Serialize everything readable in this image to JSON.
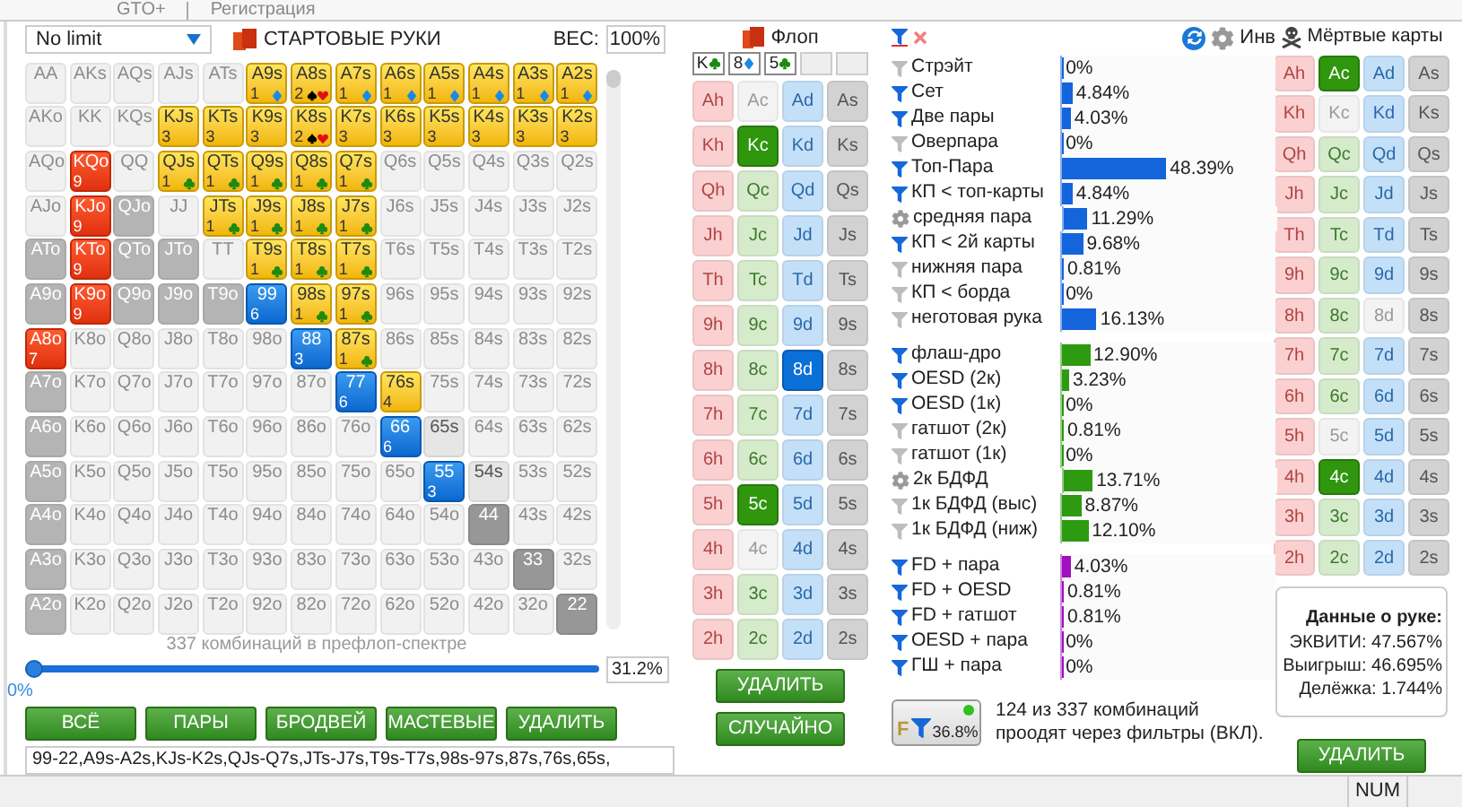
{
  "top_tabs": [
    {
      "label": "GTO+"
    },
    {
      "label": "Регистрация"
    }
  ],
  "preflop": {
    "game": "No limit",
    "title": "СТАРТОВЫЕ РУКИ",
    "weight_label": "ВЕС:",
    "weight": "100%",
    "matrix": [
      [
        {
          "label": "AA",
          "kind": "off"
        },
        {
          "label": "AKs",
          "kind": "off"
        },
        {
          "label": "AQs",
          "kind": "off"
        },
        {
          "label": "AJs",
          "kind": "off"
        },
        {
          "label": "ATs",
          "kind": "off"
        },
        {
          "label": "A9s",
          "kind": "yellow",
          "count": "1",
          "suits": [
            {
              "kind": "diamond"
            }
          ]
        },
        {
          "label": "A8s",
          "kind": "yellow",
          "count": "2",
          "suits": [
            {
              "kind": "spade"
            },
            {
              "kind": "heart"
            }
          ]
        },
        {
          "label": "A7s",
          "kind": "yellow",
          "count": "1",
          "suits": [
            {
              "kind": "diamond"
            }
          ]
        },
        {
          "label": "A6s",
          "kind": "yellow",
          "count": "1",
          "suits": [
            {
              "kind": "diamond"
            }
          ]
        },
        {
          "label": "A5s",
          "kind": "yellow",
          "count": "1",
          "suits": [
            {
              "kind": "diamond"
            }
          ]
        },
        {
          "label": "A4s",
          "kind": "yellow",
          "count": "1",
          "suits": [
            {
              "kind": "diamond"
            }
          ]
        },
        {
          "label": "A3s",
          "kind": "yellow",
          "count": "1",
          "suits": [
            {
              "kind": "diamond"
            }
          ]
        },
        {
          "label": "A2s",
          "kind": "yellow",
          "count": "1",
          "suits": [
            {
              "kind": "diamond"
            }
          ]
        }
      ],
      [
        {
          "label": "AKo",
          "kind": "off"
        },
        {
          "label": "KK",
          "kind": "off"
        },
        {
          "label": "KQs",
          "kind": "off"
        },
        {
          "label": "KJs",
          "kind": "yellow",
          "count": "3"
        },
        {
          "label": "KTs",
          "kind": "yellow",
          "count": "3"
        },
        {
          "label": "K9s",
          "kind": "yellow",
          "count": "3"
        },
        {
          "label": "K8s",
          "kind": "yellow",
          "count": "2",
          "suits": [
            {
              "kind": "spade"
            },
            {
              "kind": "heart"
            }
          ]
        },
        {
          "label": "K7s",
          "kind": "yellow",
          "count": "3"
        },
        {
          "label": "K6s",
          "kind": "yellow",
          "count": "3"
        },
        {
          "label": "K5s",
          "kind": "yellow",
          "count": "3"
        },
        {
          "label": "K4s",
          "kind": "yellow",
          "count": "3"
        },
        {
          "label": "K3s",
          "kind": "yellow",
          "count": "3"
        },
        {
          "label": "K2s",
          "kind": "yellow",
          "count": "3"
        }
      ],
      [
        {
          "label": "AQo",
          "kind": "off"
        },
        {
          "label": "KQo",
          "kind": "red",
          "count": "9"
        },
        {
          "label": "QQ",
          "kind": "off"
        },
        {
          "label": "QJs",
          "kind": "yellow",
          "count": "1",
          "suits": [
            {
              "kind": "club"
            }
          ]
        },
        {
          "label": "QTs",
          "kind": "yellow",
          "count": "1",
          "suits": [
            {
              "kind": "club"
            }
          ]
        },
        {
          "label": "Q9s",
          "kind": "yellow",
          "count": "1",
          "suits": [
            {
              "kind": "club"
            }
          ]
        },
        {
          "label": "Q8s",
          "kind": "yellow",
          "count": "1",
          "suits": [
            {
              "kind": "club"
            }
          ]
        },
        {
          "label": "Q7s",
          "kind": "yellow",
          "count": "1",
          "suits": [
            {
              "kind": "club"
            }
          ]
        },
        {
          "label": "Q6s",
          "kind": "off"
        },
        {
          "label": "Q5s",
          "kind": "off"
        },
        {
          "label": "Q4s",
          "kind": "off"
        },
        {
          "label": "Q3s",
          "kind": "off"
        },
        {
          "label": "Q2s",
          "kind": "off"
        }
      ],
      [
        {
          "label": "AJo",
          "kind": "off"
        },
        {
          "label": "KJo",
          "kind": "red",
          "count": "9"
        },
        {
          "label": "QJo",
          "kind": "grey"
        },
        {
          "label": "JJ",
          "kind": "off"
        },
        {
          "label": "JTs",
          "kind": "yellow",
          "count": "1",
          "suits": [
            {
              "kind": "club"
            }
          ]
        },
        {
          "label": "J9s",
          "kind": "yellow",
          "count": "1",
          "suits": [
            {
              "kind": "club"
            }
          ]
        },
        {
          "label": "J8s",
          "kind": "yellow",
          "count": "1",
          "suits": [
            {
              "kind": "club"
            }
          ]
        },
        {
          "label": "J7s",
          "kind": "yellow",
          "count": "1",
          "suits": [
            {
              "kind": "club"
            }
          ]
        },
        {
          "label": "J6s",
          "kind": "off"
        },
        {
          "label": "J5s",
          "kind": "off"
        },
        {
          "label": "J4s",
          "kind": "off"
        },
        {
          "label": "J3s",
          "kind": "off"
        },
        {
          "label": "J2s",
          "kind": "off"
        }
      ],
      [
        {
          "label": "ATo",
          "kind": "grey"
        },
        {
          "label": "KTo",
          "kind": "red",
          "count": "9"
        },
        {
          "label": "QTo",
          "kind": "grey"
        },
        {
          "label": "JTo",
          "kind": "grey"
        },
        {
          "label": "TT",
          "kind": "off"
        },
        {
          "label": "T9s",
          "kind": "yellow",
          "count": "1",
          "suits": [
            {
              "kind": "club"
            }
          ]
        },
        {
          "label": "T8s",
          "kind": "yellow",
          "count": "1",
          "suits": [
            {
              "kind": "club"
            }
          ]
        },
        {
          "label": "T7s",
          "kind": "yellow",
          "count": "1",
          "suits": [
            {
              "kind": "club"
            }
          ]
        },
        {
          "label": "T6s",
          "kind": "off"
        },
        {
          "label": "T5s",
          "kind": "off"
        },
        {
          "label": "T4s",
          "kind": "off"
        },
        {
          "label": "T3s",
          "kind": "off"
        },
        {
          "label": "T2s",
          "kind": "off"
        }
      ],
      [
        {
          "label": "A9o",
          "kind": "grey"
        },
        {
          "label": "K9o",
          "kind": "red",
          "count": "9"
        },
        {
          "label": "Q9o",
          "kind": "grey"
        },
        {
          "label": "J9o",
          "kind": "grey"
        },
        {
          "label": "T9o",
          "kind": "grey"
        },
        {
          "label": "99",
          "kind": "blue",
          "count": "6"
        },
        {
          "label": "98s",
          "kind": "yellow",
          "count": "1",
          "suits": [
            {
              "kind": "club"
            }
          ]
        },
        {
          "label": "97s",
          "kind": "yellow",
          "count": "1",
          "suits": [
            {
              "kind": "club"
            }
          ]
        },
        {
          "label": "96s",
          "kind": "off"
        },
        {
          "label": "95s",
          "kind": "off"
        },
        {
          "label": "94s",
          "kind": "off"
        },
        {
          "label": "93s",
          "kind": "off"
        },
        {
          "label": "92s",
          "kind": "off"
        }
      ],
      [
        {
          "label": "A8o",
          "kind": "red",
          "count": "7"
        },
        {
          "label": "K8o",
          "kind": "off"
        },
        {
          "label": "Q8o",
          "kind": "off"
        },
        {
          "label": "J8o",
          "kind": "off"
        },
        {
          "label": "T8o",
          "kind": "off"
        },
        {
          "label": "98o",
          "kind": "off"
        },
        {
          "label": "88",
          "kind": "blue",
          "count": "3"
        },
        {
          "label": "87s",
          "kind": "yellow",
          "count": "1",
          "suits": [
            {
              "kind": "club"
            }
          ]
        },
        {
          "label": "86s",
          "kind": "off"
        },
        {
          "label": "85s",
          "kind": "off"
        },
        {
          "label": "84s",
          "kind": "off"
        },
        {
          "label": "83s",
          "kind": "off"
        },
        {
          "label": "82s",
          "kind": "off"
        }
      ],
      [
        {
          "label": "A7o",
          "kind": "grey"
        },
        {
          "label": "K7o",
          "kind": "off"
        },
        {
          "label": "Q7o",
          "kind": "off"
        },
        {
          "label": "J7o",
          "kind": "off"
        },
        {
          "label": "T7o",
          "kind": "off"
        },
        {
          "label": "97o",
          "kind": "off"
        },
        {
          "label": "87o",
          "kind": "off"
        },
        {
          "label": "77",
          "kind": "blue",
          "count": "6"
        },
        {
          "label": "76s",
          "kind": "yellow",
          "count": "4"
        },
        {
          "label": "75s",
          "kind": "off"
        },
        {
          "label": "74s",
          "kind": "off"
        },
        {
          "label": "73s",
          "kind": "off"
        },
        {
          "label": "72s",
          "kind": "off"
        }
      ],
      [
        {
          "label": "A6o",
          "kind": "grey"
        },
        {
          "label": "K6o",
          "kind": "off"
        },
        {
          "label": "Q6o",
          "kind": "off"
        },
        {
          "label": "J6o",
          "kind": "off"
        },
        {
          "label": "T6o",
          "kind": "off"
        },
        {
          "label": "96o",
          "kind": "off"
        },
        {
          "label": "86o",
          "kind": "off"
        },
        {
          "label": "76o",
          "kind": "off"
        },
        {
          "label": "66",
          "kind": "blue",
          "count": "6"
        },
        {
          "label": "65s",
          "kind": "mid"
        },
        {
          "label": "64s",
          "kind": "off"
        },
        {
          "label": "63s",
          "kind": "off"
        },
        {
          "label": "62s",
          "kind": "off"
        }
      ],
      [
        {
          "label": "A5o",
          "kind": "grey"
        },
        {
          "label": "K5o",
          "kind": "off"
        },
        {
          "label": "Q5o",
          "kind": "off"
        },
        {
          "label": "J5o",
          "kind": "off"
        },
        {
          "label": "T5o",
          "kind": "off"
        },
        {
          "label": "95o",
          "kind": "off"
        },
        {
          "label": "85o",
          "kind": "off"
        },
        {
          "label": "75o",
          "kind": "off"
        },
        {
          "label": "65o",
          "kind": "off"
        },
        {
          "label": "55",
          "kind": "blue",
          "count": "3"
        },
        {
          "label": "54s",
          "kind": "mid"
        },
        {
          "label": "53s",
          "kind": "off"
        },
        {
          "label": "52s",
          "kind": "off"
        }
      ],
      [
        {
          "label": "A4o",
          "kind": "grey"
        },
        {
          "label": "K4o",
          "kind": "off"
        },
        {
          "label": "Q4o",
          "kind": "off"
        },
        {
          "label": "J4o",
          "kind": "off"
        },
        {
          "label": "T4o",
          "kind": "off"
        },
        {
          "label": "94o",
          "kind": "off"
        },
        {
          "label": "84o",
          "kind": "off"
        },
        {
          "label": "74o",
          "kind": "off"
        },
        {
          "label": "64o",
          "kind": "off"
        },
        {
          "label": "54o",
          "kind": "off"
        },
        {
          "label": "44",
          "kind": "dark"
        },
        {
          "label": "43s",
          "kind": "off"
        },
        {
          "label": "42s",
          "kind": "off"
        }
      ],
      [
        {
          "label": "A3o",
          "kind": "grey"
        },
        {
          "label": "K3o",
          "kind": "off"
        },
        {
          "label": "Q3o",
          "kind": "off"
        },
        {
          "label": "J3o",
          "kind": "off"
        },
        {
          "label": "T3o",
          "kind": "off"
        },
        {
          "label": "93o",
          "kind": "off"
        },
        {
          "label": "83o",
          "kind": "off"
        },
        {
          "label": "73o",
          "kind": "off"
        },
        {
          "label": "63o",
          "kind": "off"
        },
        {
          "label": "53o",
          "kind": "off"
        },
        {
          "label": "43o",
          "kind": "off"
        },
        {
          "label": "33",
          "kind": "dark"
        },
        {
          "label": "32s",
          "kind": "off"
        }
      ],
      [
        {
          "label": "A2o",
          "kind": "grey"
        },
        {
          "label": "K2o",
          "kind": "off"
        },
        {
          "label": "Q2o",
          "kind": "off"
        },
        {
          "label": "J2o",
          "kind": "off"
        },
        {
          "label": "T2o",
          "kind": "off"
        },
        {
          "label": "92o",
          "kind": "off"
        },
        {
          "label": "82o",
          "kind": "off"
        },
        {
          "label": "72o",
          "kind": "off"
        },
        {
          "label": "62o",
          "kind": "off"
        },
        {
          "label": "52o",
          "kind": "off"
        },
        {
          "label": "42o",
          "kind": "off"
        },
        {
          "label": "32o",
          "kind": "off"
        },
        {
          "label": "22",
          "kind": "dark"
        }
      ]
    ],
    "combos_caption": "337 комбинаций в префлоп-спектре",
    "slider": {
      "level": 0,
      "min_label": "0%",
      "max_value": "31.2%"
    },
    "buttons": [
      "ВСЁ",
      "ПАРЫ",
      "БРОДВЕЙ",
      "МАСТЕВЫЕ",
      "УДАЛИТЬ"
    ],
    "range_text": "99-22,A9s-A2s,KJs-K2s,QJs-Q7s,JTs-J7s,T9s-T7s,98s-97s,87s,76s,65s,"
  },
  "flop": {
    "title": "Флоп",
    "board": [
      {
        "kind": "club",
        "rank": "K"
      },
      {
        "kind": "diamond",
        "rank": "8"
      },
      {
        "kind": "club",
        "rank": "5"
      },
      {
        "kind": "empty"
      },
      {
        "kind": "empty"
      }
    ],
    "cards": [
      [
        {
          "label": "Ah",
          "selected": false,
          "disabled": false
        },
        {
          "label": "Ac",
          "selected": false,
          "disabled": true
        },
        {
          "label": "Ad",
          "selected": false,
          "disabled": false
        },
        {
          "label": "As",
          "selected": false,
          "disabled": false
        }
      ],
      [
        {
          "label": "Kh",
          "selected": false,
          "disabled": false
        },
        {
          "label": "Kc",
          "selected": true,
          "disabled": false
        },
        {
          "label": "Kd",
          "selected": false,
          "disabled": false
        },
        {
          "label": "Ks",
          "selected": false,
          "disabled": false
        }
      ],
      [
        {
          "label": "Qh",
          "selected": false,
          "disabled": false
        },
        {
          "label": "Qc",
          "selected": false,
          "disabled": false
        },
        {
          "label": "Qd",
          "selected": false,
          "disabled": false
        },
        {
          "label": "Qs",
          "selected": false,
          "disabled": false
        }
      ],
      [
        {
          "label": "Jh",
          "selected": false,
          "disabled": false
        },
        {
          "label": "Jc",
          "selected": false,
          "disabled": false
        },
        {
          "label": "Jd",
          "selected": false,
          "disabled": false
        },
        {
          "label": "Js",
          "selected": false,
          "disabled": false
        }
      ],
      [
        {
          "label": "Th",
          "selected": false,
          "disabled": false
        },
        {
          "label": "Tc",
          "selected": false,
          "disabled": false
        },
        {
          "label": "Td",
          "selected": false,
          "disabled": false
        },
        {
          "label": "Ts",
          "selected": false,
          "disabled": false
        }
      ],
      [
        {
          "label": "9h",
          "selected": false,
          "disabled": false
        },
        {
          "label": "9c",
          "selected": false,
          "disabled": false
        },
        {
          "label": "9d",
          "selected": false,
          "disabled": false
        },
        {
          "label": "9s",
          "selected": false,
          "disabled": false
        }
      ],
      [
        {
          "label": "8h",
          "selected": false,
          "disabled": false
        },
        {
          "label": "8c",
          "selected": false,
          "disabled": false
        },
        {
          "label": "8d",
          "selected": true,
          "disabled": false
        },
        {
          "label": "8s",
          "selected": false,
          "disabled": false
        }
      ],
      [
        {
          "label": "7h",
          "selected": false,
          "disabled": false
        },
        {
          "label": "7c",
          "selected": false,
          "disabled": false
        },
        {
          "label": "7d",
          "selected": false,
          "disabled": false
        },
        {
          "label": "7s",
          "selected": false,
          "disabled": false
        }
      ],
      [
        {
          "label": "6h",
          "selected": false,
          "disabled": false
        },
        {
          "label": "6c",
          "selected": false,
          "disabled": false
        },
        {
          "label": "6d",
          "selected": false,
          "disabled": false
        },
        {
          "label": "6s",
          "selected": false,
          "disabled": false
        }
      ],
      [
        {
          "label": "5h",
          "selected": false,
          "disabled": false
        },
        {
          "label": "5c",
          "selected": true,
          "disabled": false
        },
        {
          "label": "5d",
          "selected": false,
          "disabled": false
        },
        {
          "label": "5s",
          "selected": false,
          "disabled": false
        }
      ],
      [
        {
          "label": "4h",
          "selected": false,
          "disabled": false
        },
        {
          "label": "4c",
          "selected": false,
          "disabled": true
        },
        {
          "label": "4d",
          "selected": false,
          "disabled": false
        },
        {
          "label": "4s",
          "selected": false,
          "disabled": false
        }
      ],
      [
        {
          "label": "3h",
          "selected": false,
          "disabled": false
        },
        {
          "label": "3c",
          "selected": false,
          "disabled": false
        },
        {
          "label": "3d",
          "selected": false,
          "disabled": false
        },
        {
          "label": "3s",
          "selected": false,
          "disabled": false
        }
      ],
      [
        {
          "label": "2h",
          "selected": false,
          "disabled": false
        },
        {
          "label": "2c",
          "selected": false,
          "disabled": false
        },
        {
          "label": "2d",
          "selected": false,
          "disabled": false
        },
        {
          "label": "2s",
          "selected": false,
          "disabled": false
        }
      ]
    ],
    "buttons": [
      "УДАЛИТЬ",
      "СЛУЧАЙНО"
    ]
  },
  "stats": {
    "groups": [
      {
        "color": "#1464dc",
        "rows": [
          {
            "kind": "off",
            "label": "Стрэйт",
            "value": "0%",
            "level": 0
          },
          {
            "kind": "on",
            "label": "Сет",
            "value": "4.84%",
            "level": 0.0484
          },
          {
            "kind": "on",
            "label": "Две пары",
            "value": "4.03%",
            "level": 0.0403
          },
          {
            "kind": "off",
            "label": "Оверпара",
            "value": "0%",
            "level": 0
          },
          {
            "kind": "on",
            "label": "Топ-Пара",
            "value": "48.39%",
            "level": 0.4839
          },
          {
            "kind": "on",
            "label": "КП < топ-карты",
            "value": "4.84%",
            "level": 0.0484
          },
          {
            "kind": "gear",
            "label": "средняя пара",
            "value": "11.29%",
            "level": 0.1129
          },
          {
            "kind": "on",
            "label": "КП < 2й карты",
            "value": "9.68%",
            "level": 0.0968
          },
          {
            "kind": "off",
            "label": "нижняя пара",
            "value": "0.81%",
            "level": 0.0081
          },
          {
            "kind": "off",
            "label": "КП < борда",
            "value": "0%",
            "level": 0
          },
          {
            "kind": "off",
            "label": "неготовая рука",
            "value": "16.13%",
            "level": 0.1613
          }
        ]
      },
      {
        "color": "#2e9a12",
        "rows": [
          {
            "kind": "on",
            "label": "флаш-дро",
            "value": "12.90%",
            "level": 0.129
          },
          {
            "kind": "on",
            "label": "OESD (2к)",
            "value": "3.23%",
            "level": 0.0323
          },
          {
            "kind": "on",
            "label": "OESD (1к)",
            "value": "0%",
            "level": 0
          },
          {
            "kind": "off",
            "label": "гатшот (2к)",
            "value": "0.81%",
            "level": 0.0081
          },
          {
            "kind": "off",
            "label": "гатшот (1к)",
            "value": "0%",
            "level": 0
          },
          {
            "kind": "gear",
            "label": "2к БДФД",
            "value": "13.71%",
            "level": 0.1371
          },
          {
            "kind": "off",
            "label": "1к БДФД (выс)",
            "value": "8.87%",
            "level": 0.0887
          },
          {
            "kind": "off",
            "label": "1к БДФД (ниж)",
            "value": "12.10%",
            "level": 0.121
          }
        ]
      },
      {
        "color": "#a010c0",
        "rows": [
          {
            "kind": "on",
            "label": "FD + пара",
            "value": "4.03%",
            "level": 0.0403
          },
          {
            "kind": "on",
            "label": "FD + OESD",
            "value": "0.81%",
            "level": 0.0081
          },
          {
            "kind": "on",
            "label": "FD + гатшот",
            "value": "0.81%",
            "level": 0.0081
          },
          {
            "kind": "on",
            "label": "OESD + пара",
            "value": "0%",
            "level": 0
          },
          {
            "kind": "on",
            "label": "ГШ + пара",
            "value": "0%",
            "level": 0
          }
        ]
      }
    ],
    "inv_label": "Инв",
    "filter_button": {
      "letter": "F",
      "value": "36.8%",
      "on": true
    },
    "summary": "124 из 337 комбинаций проодят через фильтры (ВКЛ)."
  },
  "dead_cards": {
    "title": "Мёртвые карты",
    "cards": [
      [
        {
          "label": "Ah",
          "selected": false,
          "disabled": false
        },
        {
          "label": "Ac",
          "selected": true,
          "disabled": false
        },
        {
          "label": "Ad",
          "selected": false,
          "disabled": false
        },
        {
          "label": "As",
          "selected": false,
          "disabled": false
        }
      ],
      [
        {
          "label": "Kh",
          "selected": false,
          "disabled": false
        },
        {
          "label": "Kc",
          "selected": false,
          "disabled": true
        },
        {
          "label": "Kd",
          "selected": false,
          "disabled": false
        },
        {
          "label": "Ks",
          "selected": false,
          "disabled": false
        }
      ],
      [
        {
          "label": "Qh",
          "selected": false,
          "disabled": false
        },
        {
          "label": "Qc",
          "selected": false,
          "disabled": false
        },
        {
          "label": "Qd",
          "selected": false,
          "disabled": false
        },
        {
          "label": "Qs",
          "selected": false,
          "disabled": false
        }
      ],
      [
        {
          "label": "Jh",
          "selected": false,
          "disabled": false
        },
        {
          "label": "Jc",
          "selected": false,
          "disabled": false
        },
        {
          "label": "Jd",
          "selected": false,
          "disabled": false
        },
        {
          "label": "Js",
          "selected": false,
          "disabled": false
        }
      ],
      [
        {
          "label": "Th",
          "selected": false,
          "disabled": false
        },
        {
          "label": "Tc",
          "selected": false,
          "disabled": false
        },
        {
          "label": "Td",
          "selected": false,
          "disabled": false
        },
        {
          "label": "Ts",
          "selected": false,
          "disabled": false
        }
      ],
      [
        {
          "label": "9h",
          "selected": false,
          "disabled": false
        },
        {
          "label": "9c",
          "selected": false,
          "disabled": false
        },
        {
          "label": "9d",
          "selected": false,
          "disabled": false
        },
        {
          "label": "9s",
          "selected": false,
          "disabled": false
        }
      ],
      [
        {
          "label": "8h",
          "selected": false,
          "disabled": false
        },
        {
          "label": "8c",
          "selected": false,
          "disabled": false
        },
        {
          "label": "8d",
          "selected": false,
          "disabled": true
        },
        {
          "label": "8s",
          "selected": false,
          "disabled": false
        }
      ],
      [
        {
          "label": "7h",
          "selected": false,
          "disabled": false
        },
        {
          "label": "7c",
          "selected": false,
          "disabled": false
        },
        {
          "label": "7d",
          "selected": false,
          "disabled": false
        },
        {
          "label": "7s",
          "selected": false,
          "disabled": false
        }
      ],
      [
        {
          "label": "6h",
          "selected": false,
          "disabled": false
        },
        {
          "label": "6c",
          "selected": false,
          "disabled": false
        },
        {
          "label": "6d",
          "selected": false,
          "disabled": false
        },
        {
          "label": "6s",
          "selected": false,
          "disabled": false
        }
      ],
      [
        {
          "label": "5h",
          "selected": false,
          "disabled": false
        },
        {
          "label": "5c",
          "selected": false,
          "disabled": true
        },
        {
          "label": "5d",
          "selected": false,
          "disabled": false
        },
        {
          "label": "5s",
          "selected": false,
          "disabled": false
        }
      ],
      [
        {
          "label": "4h",
          "selected": false,
          "disabled": false
        },
        {
          "label": "4c",
          "selected": true,
          "disabled": false
        },
        {
          "label": "4d",
          "selected": false,
          "disabled": false
        },
        {
          "label": "4s",
          "selected": false,
          "disabled": false
        }
      ],
      [
        {
          "label": "3h",
          "selected": false,
          "disabled": false
        },
        {
          "label": "3c",
          "selected": false,
          "disabled": false
        },
        {
          "label": "3d",
          "selected": false,
          "disabled": false
        },
        {
          "label": "3s",
          "selected": false,
          "disabled": false
        }
      ],
      [
        {
          "label": "2h",
          "selected": false,
          "disabled": false
        },
        {
          "label": "2c",
          "selected": false,
          "disabled": false
        },
        {
          "label": "2d",
          "selected": false,
          "disabled": false
        },
        {
          "label": "2s",
          "selected": false,
          "disabled": false
        }
      ]
    ],
    "hand_info": {
      "title": "Данные о руке:",
      "lines": [
        "ЭКВИТИ: 47.567%",
        "Выигрыш: 46.695%",
        "Делёжка: 1.744%"
      ]
    },
    "button": "УДАЛИТЬ"
  },
  "status_bar": {
    "num": "NUM"
  }
}
